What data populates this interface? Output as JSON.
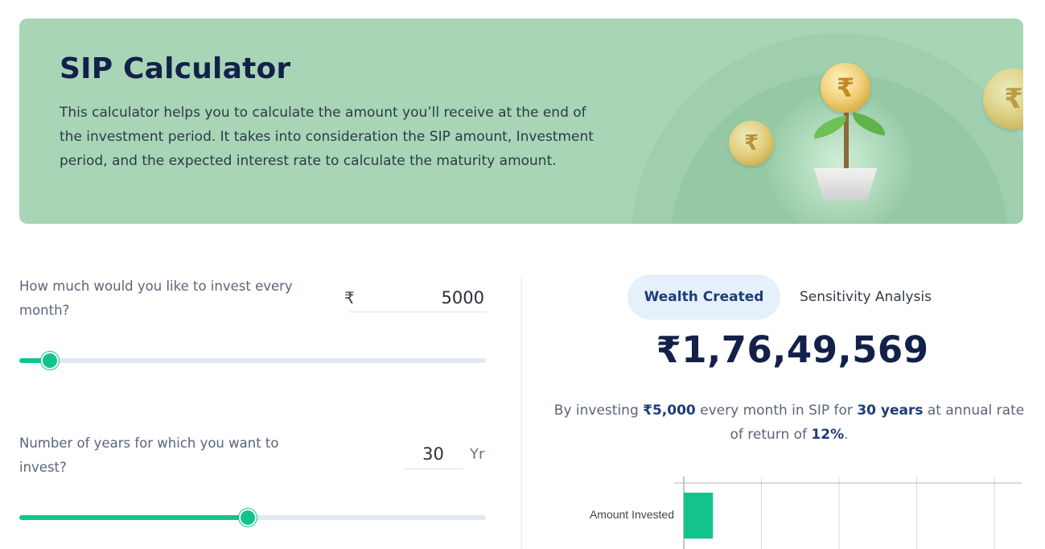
{
  "banner": {
    "title": "SIP Calculator",
    "description": "This calculator helps you to calculate the amount you’ll receive at the end of the investment period. It takes into consideration the SIP amount, Investment period, and the expected interest rate to calculate the maturity amount.",
    "coin_symbol": "₹"
  },
  "inputs": {
    "monthly": {
      "question": "How much would you like to invest every month?",
      "currency": "₹",
      "value": "5000",
      "slider_fraction": 0.065
    },
    "years": {
      "question": "Number of years for which you want to invest?",
      "value": "30",
      "unit": "Yr",
      "slider_fraction": 0.49
    }
  },
  "result": {
    "tabs": [
      "Wealth Created",
      "Sensitivity Analysis"
    ],
    "active_tab": "Wealth Created",
    "amount": "₹1,76,49,569",
    "summary": {
      "prefix": "By investing ",
      "amount": "₹5,000",
      "mid1": " every month in SIP for ",
      "years": "30 years",
      "mid2": " at annual rate of return of ",
      "rate": "12%",
      "suffix": "."
    }
  },
  "chart_data": {
    "type": "bar",
    "orientation": "horizontal",
    "categories": [
      "Amount Invested"
    ],
    "series": [
      {
        "values": [
          1800000
        ]
      }
    ],
    "bar_color": "#12c48b",
    "grid": true
  },
  "colors": {
    "accent": "#12c48b",
    "banner": "#a8d5b5",
    "title": "#13214a",
    "highlight": "#1e3d7b"
  }
}
